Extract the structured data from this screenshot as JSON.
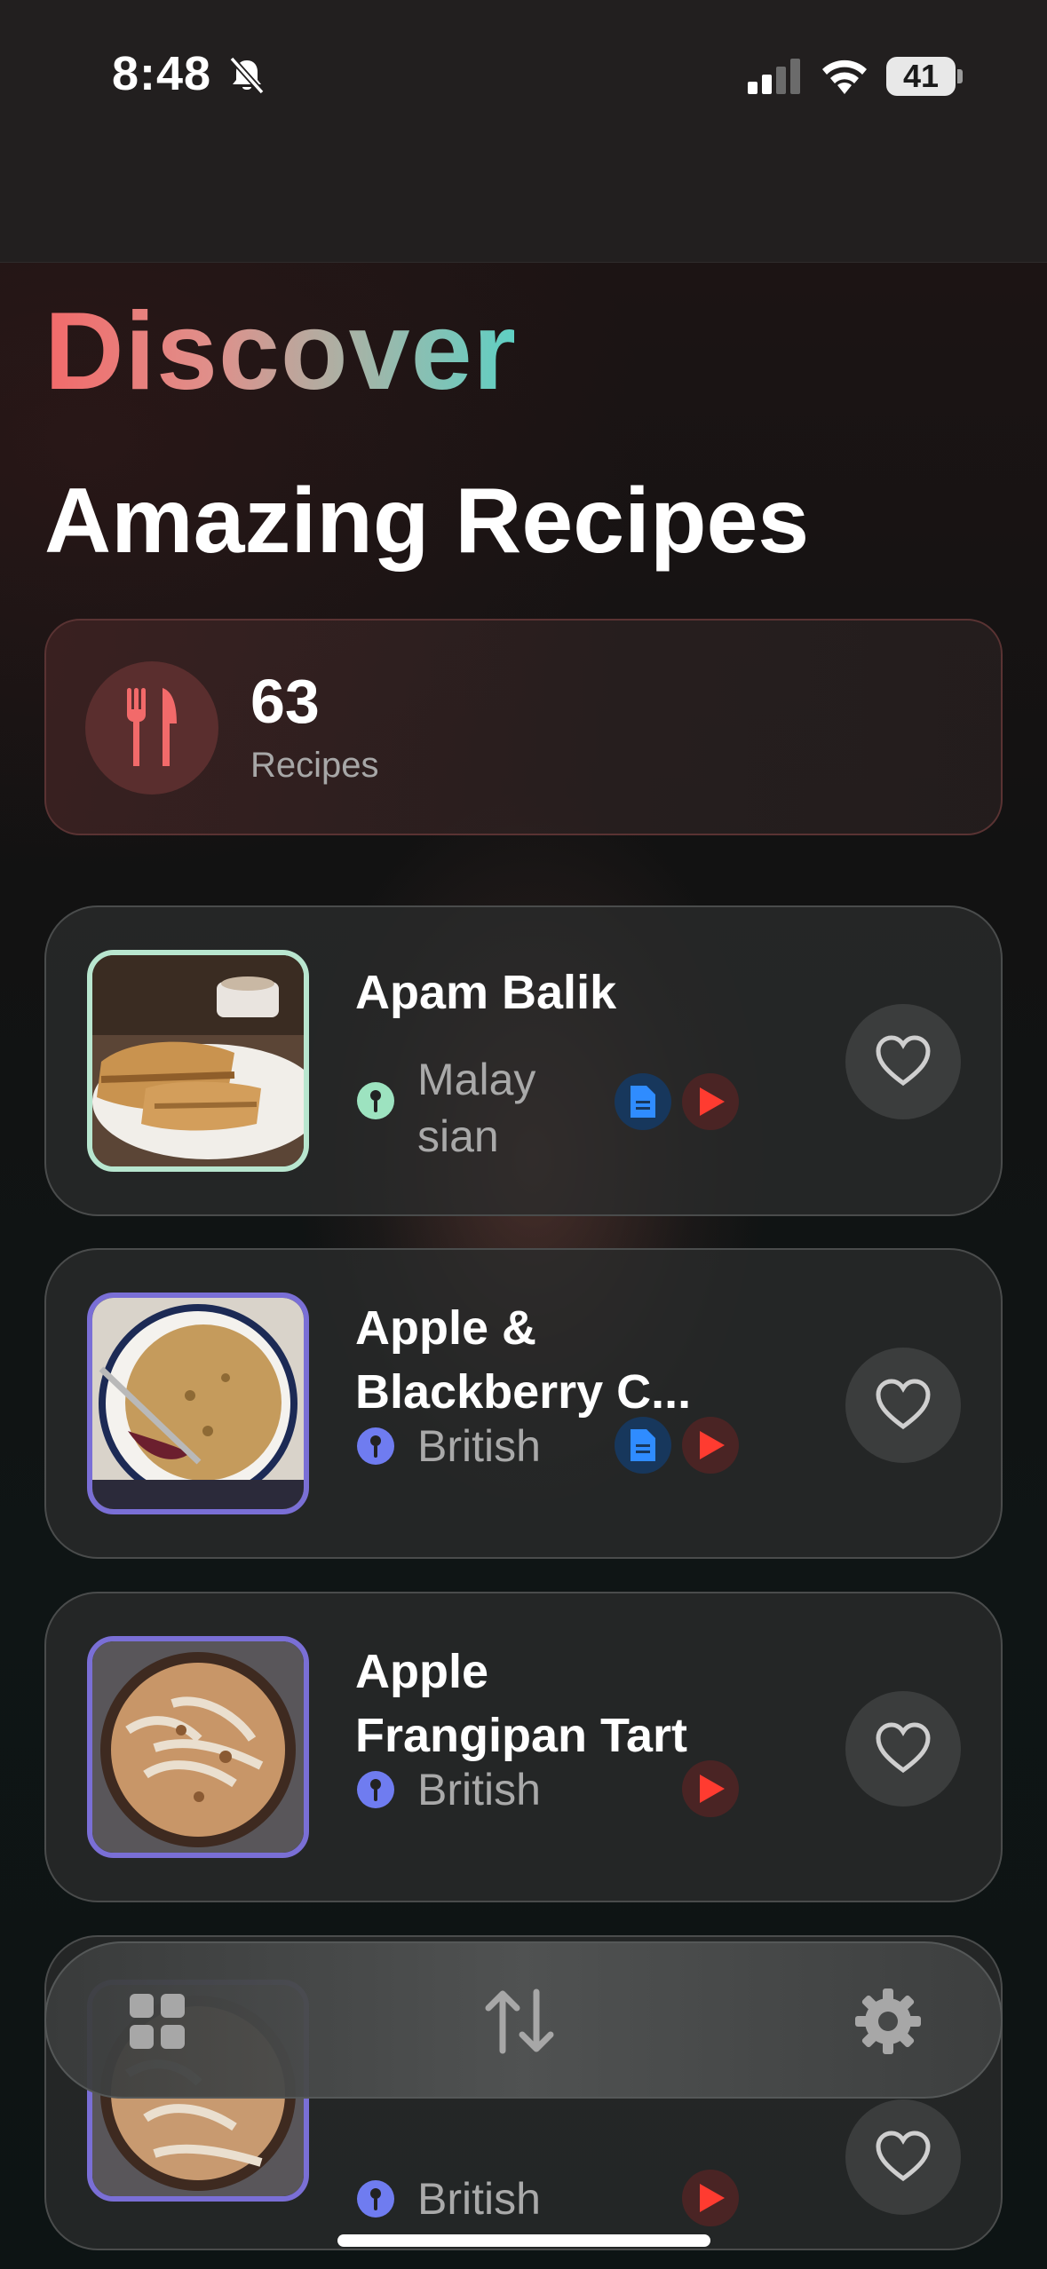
{
  "status_bar": {
    "time": "8:48",
    "battery": "41"
  },
  "header": {
    "title": "Discover",
    "subtitle": "Amazing Recipes"
  },
  "stats": {
    "count": "63",
    "label": "Recipes"
  },
  "recipes": [
    {
      "title_lines": [
        "Apam Balik"
      ],
      "cuisine_lines": [
        "Malay",
        "sian"
      ],
      "has_document": true,
      "has_video": true,
      "pin_color": "#9de3c0"
    },
    {
      "title_lines": [
        "Apple &",
        "Blackberry C..."
      ],
      "cuisine_lines": [
        "British"
      ],
      "has_document": true,
      "has_video": true,
      "pin_color": "#6f7cf0"
    },
    {
      "title_lines": [
        "Apple",
        "Frangipan Tart"
      ],
      "cuisine_lines": [
        "British"
      ],
      "has_document": false,
      "has_video": true,
      "pin_color": "#6f7cf0"
    },
    {
      "title_lines": [],
      "cuisine_lines": [
        "British"
      ],
      "has_document": false,
      "has_video": true,
      "pin_color": "#6f7cf0"
    }
  ],
  "tab_bar": {
    "icons": [
      "grid-icon",
      "sort-icon",
      "gear-icon"
    ]
  },
  "colors": {
    "accent": "#f26a6a",
    "teal": "#5ed0c4",
    "play_red": "#ff3b30",
    "doc_blue": "#2f8cff"
  }
}
